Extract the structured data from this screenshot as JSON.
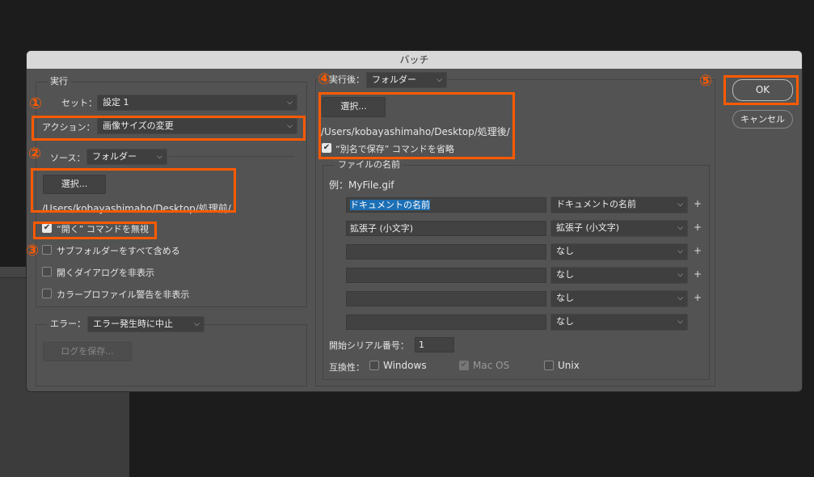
{
  "window": {
    "title": "バッチ"
  },
  "play": {
    "group_label": "実行",
    "set_label": "セット：",
    "set_value": "設定 1",
    "action_label": "アクション：",
    "action_value": "画像サイズの変更"
  },
  "source": {
    "label": "ソース：",
    "value": "フォルダー",
    "choose_button": "選択...",
    "path": "/Users/kobayashimaho/Desktop/処理前/",
    "options": [
      {
        "label": "“開く” コマンドを無視",
        "checked": true
      },
      {
        "label": "サブフォルダーをすべて含める",
        "checked": false
      },
      {
        "label": "開くダイアログを非表示",
        "checked": false
      },
      {
        "label": "カラープロファイル警告を非表示",
        "checked": false
      }
    ]
  },
  "errors": {
    "label": "エラー：",
    "value": "エラー発生時に中止",
    "save_log_button": "ログを保存..."
  },
  "destination": {
    "label": "実行後：",
    "value": "フォルダー",
    "choose_button": "選択...",
    "path": "/Users/kobayashimaho/Desktop/処理後/",
    "override_label": "“別名で保存” コマンドを省略",
    "override_checked": true
  },
  "file_naming": {
    "group_label": "ファイルの名前",
    "example": "例：MyFile.gif",
    "rows": [
      {
        "text": "ドキュメントの名前",
        "select": "ドキュメントの名前",
        "plus": "+"
      },
      {
        "text": "拡張子 (小文字)",
        "select": "拡張子 (小文字)",
        "plus": "+"
      },
      {
        "text": "",
        "select": "なし",
        "plus": "+"
      },
      {
        "text": "",
        "select": "なし",
        "plus": "+"
      },
      {
        "text": "",
        "select": "なし",
        "plus": "+"
      },
      {
        "text": "",
        "select": "なし",
        "plus": ""
      }
    ],
    "serial_label": "開始シリアル番号：",
    "serial_value": "1",
    "compat_label": "互換性：",
    "compat": [
      {
        "label": "Windows",
        "checked": false,
        "disabled": false
      },
      {
        "label": "Mac OS",
        "checked": true,
        "disabled": true
      },
      {
        "label": "Unix",
        "checked": false,
        "disabled": false
      }
    ]
  },
  "buttons": {
    "ok": "OK",
    "cancel": "キャンセル"
  },
  "annotations": [
    "①",
    "②",
    "③",
    "④",
    "⑤"
  ],
  "colors": {
    "annotation": "#ff5a00",
    "dialog_bg": "#535353",
    "highlight": "#1d6fb5"
  }
}
